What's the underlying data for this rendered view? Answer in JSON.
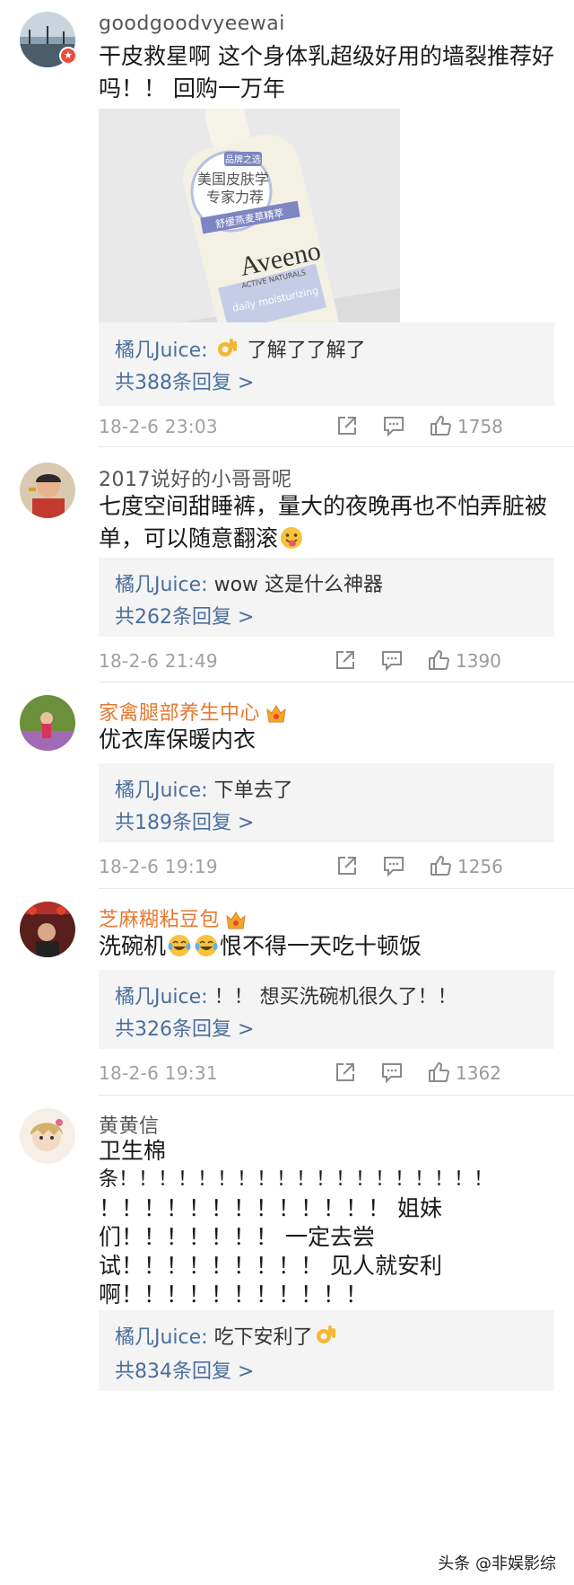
{
  "comments": [
    {
      "username": "goodgoodvyeewai",
      "text": "干皮救星啊 这个身体乳超级好用的墙裂推荐好吗！！ 回购一万年",
      "photo": {
        "badge_lines": [
          "品牌之选",
          "美国皮肤学",
          "专家力荐"
        ],
        "ribbon": "舒缓燕麦草精萃",
        "brand": "Aveeno",
        "sub": "ACTIVE NATURALS",
        "label": "daily moisturizing"
      },
      "reply": {
        "user": "橘几Juice:",
        "text": "了解了了解了",
        "count": "共388条回复 >"
      },
      "time": "18-2-6 23:03",
      "likes": "1758"
    },
    {
      "username": "2017说好的小哥哥呢",
      "text_before": "七度空间甜睡裤，量大的夜晚再也不怕弄脏被单，可以随意翻滚",
      "reply": {
        "user": "橘几Juice:",
        "text": "wow 这是什么神器",
        "count": "共262条回复 >"
      },
      "time": "18-2-6 21:49",
      "likes": "1390"
    },
    {
      "username": "家禽腿部养生中心",
      "text": "优衣库保暖内衣",
      "reply": {
        "user": "橘几Juice:",
        "text": "下单去了",
        "count": "共189条回复 >"
      },
      "time": "18-2-6 19:19",
      "likes": "1256"
    },
    {
      "username": "芝麻糊粘豆包",
      "text_before": "洗碗机",
      "text_after": "恨不得一天吃十顿饭",
      "reply": {
        "user": "橘几Juice:",
        "text": "！！ 想买洗碗机很久了！！",
        "count": "共326条回复 >"
      },
      "time": "18-2-6 19:31",
      "likes": "1362"
    },
    {
      "username": "黄黄信",
      "lines": [
        "卫生棉",
        "条！！！！！！！！！！！！！！！！！！！",
        "！！！！！！！！！！！！！ 姐妹",
        "们！！！！！！！ 一定去尝",
        "试！！！！！！！！！ 见人就安利",
        "啊！！！！！！！！！！！"
      ],
      "reply": {
        "user": "橘几Juice:",
        "text": "吃下安利了",
        "count": "共834条回复 >"
      }
    }
  ],
  "watermark": "头条 @非娱影综",
  "colors": {
    "link": "#4a6e9c",
    "vip_name": "#e8772e",
    "reply_bg": "#f4f4f4",
    "meta": "#a0a0a0"
  },
  "icons": {
    "share": "share-icon",
    "comment": "comment-icon",
    "like": "thumbs-up-icon",
    "crown": "vip-crown-icon",
    "verified": "verified-badge-icon"
  }
}
